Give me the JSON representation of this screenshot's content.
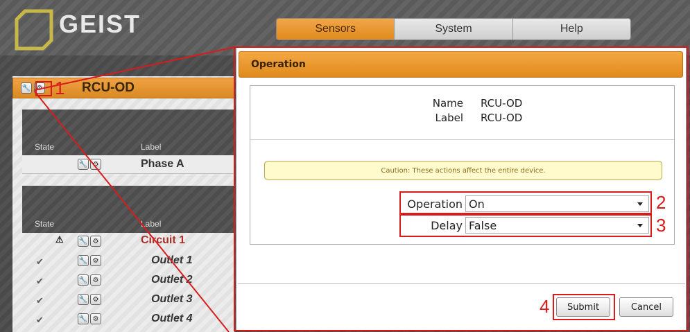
{
  "brand": {
    "name": "GEIST",
    "logo_icon": "geist-logo-icon"
  },
  "nav": {
    "tabs": [
      {
        "label": "Sensors",
        "active": true
      },
      {
        "label": "System",
        "active": false
      },
      {
        "label": "Help",
        "active": false
      }
    ]
  },
  "device": {
    "name": "RCU-OD"
  },
  "table": {
    "col_state": "State",
    "col_label": "Label",
    "phase": {
      "label": "Phase A"
    },
    "circuit": {
      "label": "Circuit 1",
      "state_icon": "warning-icon"
    },
    "outlets": [
      {
        "label": "Outlet 1",
        "state_icon": "checkmark-icon"
      },
      {
        "label": "Outlet 2",
        "state_icon": "checkmark-icon"
      },
      {
        "label": "Outlet 3",
        "state_icon": "checkmark-icon"
      },
      {
        "label": "Outlet 4",
        "state_icon": "checkmark-icon"
      }
    ]
  },
  "dialog": {
    "title": "Operation",
    "name_key": "Name",
    "name_value": "RCU-OD",
    "label_key": "Label",
    "label_value": "RCU-OD",
    "caution": "Caution: These actions affect the entire device.",
    "operation_label": "Operation",
    "operation_value": "On",
    "delay_label": "Delay",
    "delay_value": "False",
    "submit_label": "Submit",
    "cancel_label": "Cancel"
  },
  "annotations": {
    "one": "1",
    "two": "2",
    "three": "3",
    "four": "4"
  },
  "colors": {
    "accent": "#e08a1d",
    "annotation": "#d81c1c",
    "caution_bg": "#fffbcc",
    "circuit_label": "#a8322a"
  }
}
